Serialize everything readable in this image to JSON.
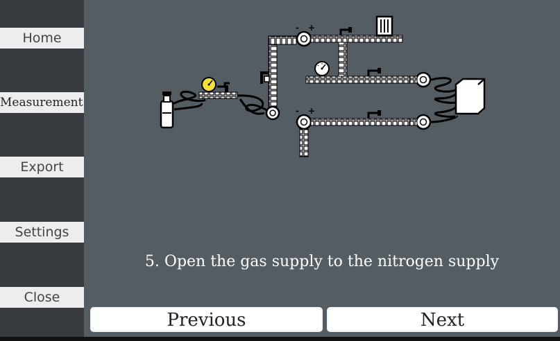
{
  "sidebar": {
    "items": [
      {
        "label": "Home"
      },
      {
        "label": "Measurement"
      },
      {
        "label": "Export"
      },
      {
        "label": "Settings"
      },
      {
        "label": "Close"
      }
    ]
  },
  "main": {
    "instruction": "5. Open the gas supply to the nitrogen supply",
    "previous_label": "Previous",
    "next_label": "Next"
  },
  "diagram": {
    "gauge_active_color": "#f5e133",
    "line_color": "#000000",
    "symbols": [
      "-",
      "+",
      "-",
      "+"
    ]
  },
  "icons": {
    "gas_cylinder": "gas-cylinder-icon",
    "pressure_gauge": "pressure-gauge-icon",
    "filter": "filter-icon",
    "oven": "chamber-icon"
  }
}
